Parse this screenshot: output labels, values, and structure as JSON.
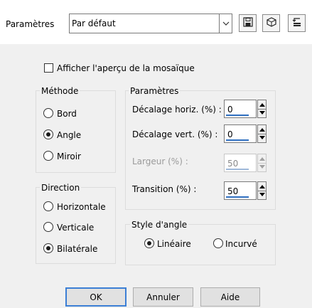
{
  "header": {
    "presets_label": "Paramètres",
    "preset_value": "Par défaut",
    "icons": [
      "save-icon",
      "cube-icon",
      "reset-icon"
    ]
  },
  "preview_checkbox": {
    "label": "Afficher l'aperçu de la mosaïque",
    "checked": false
  },
  "methode": {
    "title": "Méthode",
    "options": [
      "Bord",
      "Angle",
      "Miroir"
    ],
    "selected": "Angle"
  },
  "direction": {
    "title": "Direction",
    "options": [
      "Horizontale",
      "Verticale",
      "Bilatérale"
    ],
    "selected": "Bilatérale"
  },
  "parametres": {
    "title": "Paramètres",
    "fields": [
      {
        "label": "Décalage horiz. (%) :",
        "value": "0",
        "enabled": true
      },
      {
        "label": "Décalage vert. (%) :",
        "value": "0",
        "enabled": true
      },
      {
        "label": "Largeur (%) :",
        "value": "50",
        "enabled": false
      },
      {
        "label": "Transition (%) :",
        "value": "50",
        "enabled": true
      }
    ]
  },
  "style_angle": {
    "title": "Style d'angle",
    "options": [
      "Linéaire",
      "Incurvé"
    ],
    "selected": "Linéaire"
  },
  "buttons": {
    "ok": "OK",
    "cancel": "Annuler",
    "help": "Aide"
  },
  "colors": {
    "accent": "#3c7fd5",
    "field_underline": "#2f6fc0",
    "background": "#f0f0f0"
  }
}
